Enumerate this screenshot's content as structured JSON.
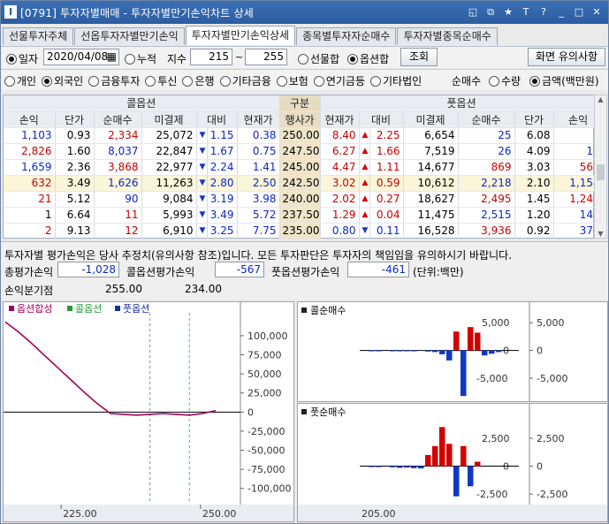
{
  "window": {
    "title": "[0791] 투자자별매매 - 투자자별만기손익차트 상세",
    "icon_letter": "I"
  },
  "titlebar_icons": [
    "restore-icon",
    "copy-icon",
    "star-icon",
    "font-icon",
    "help-icon",
    "minimize-icon",
    "maximize-icon",
    "close-icon"
  ],
  "titlebar_glyphs": [
    "◱",
    "⧉",
    "★",
    "T",
    "?",
    "_",
    "□",
    "✕"
  ],
  "tabs": [
    {
      "label": "선물투자주체",
      "active": false
    },
    {
      "label": "선옵투자자별만기손익",
      "active": false
    },
    {
      "label": "투자자별만기손익상세",
      "active": true
    },
    {
      "label": "종목별투자자순매수",
      "active": false
    },
    {
      "label": "투자자별종목순매수",
      "active": false
    }
  ],
  "controls": {
    "date_radio": "일자",
    "date_value": "2020/04/08",
    "cumulative_radio": "누적",
    "index_label": "지수",
    "index_from": "215",
    "tilde": "~",
    "index_to": "255",
    "futures_sum": "선물합",
    "options_sum": "옵션합",
    "query_button": "조회",
    "notice_button": "화면 유의사항"
  },
  "investors": [
    "개인",
    "외국인",
    "금융투자",
    "투신",
    "은행",
    "기타금융",
    "보험",
    "연기금등",
    "기타법인"
  ],
  "investor_selected": "외국인",
  "net_label": "순매수",
  "qty_radio": "수량",
  "amount_radio": "금액(백만원)",
  "table": {
    "call_header": "콜옵션",
    "mid_header": "구분",
    "put_header": "풋옵션",
    "call_cols": [
      "손익",
      "단가",
      "순매수",
      "미결제",
      "대비",
      "현재가"
    ],
    "mid_col": "행사가",
    "put_cols": [
      "현재가",
      "대비",
      "미결제",
      "순매수",
      "단가",
      "손익"
    ],
    "rows": [
      {
        "c": [
          "1,103",
          "0.93",
          "2,334",
          "25,072",
          "▼",
          "1.15",
          "0.38"
        ],
        "s": "250.00",
        "p": [
          "8.40",
          "▲",
          "2.25",
          "6,654",
          "25",
          "6.08",
          "9"
        ],
        "cc": [
          "b",
          "k",
          "r",
          "k",
          "dn",
          "b",
          "b"
        ],
        "pc": [
          "r",
          "up",
          "r",
          "k",
          "b",
          "k",
          "b"
        ],
        "hl": false
      },
      {
        "c": [
          "2,826",
          "1.60",
          "8,037",
          "22,847",
          "▼",
          "1.67",
          "0.75"
        ],
        "s": "247.50",
        "p": [
          "6.27",
          "▲",
          "1.66",
          "7,519",
          "26",
          "4.09",
          "11"
        ],
        "cc": [
          "r",
          "k",
          "b",
          "k",
          "dn",
          "b",
          "b"
        ],
        "pc": [
          "r",
          "up",
          "r",
          "k",
          "b",
          "k",
          "b"
        ],
        "hl": false
      },
      {
        "c": [
          "1,659",
          "2.36",
          "3,868",
          "22,977",
          "▼",
          "2.24",
          "1.41"
        ],
        "s": "245.00",
        "p": [
          "4.47",
          "▲",
          "1.11",
          "14,677",
          "869",
          "3.03",
          "562"
        ],
        "cc": [
          "b",
          "k",
          "r",
          "k",
          "dn",
          "b",
          "b"
        ],
        "pc": [
          "r",
          "up",
          "r",
          "k",
          "r",
          "k",
          "r"
        ],
        "hl": false
      },
      {
        "c": [
          "632",
          "3.49",
          "1,626",
          "11,263",
          "▼",
          "2.80",
          "2.50"
        ],
        "s": "242.50",
        "p": [
          "3.02",
          "▲",
          "0.59",
          "10,612",
          "2,218",
          "2.10",
          "1,154"
        ],
        "cc": [
          "r",
          "k",
          "b",
          "k",
          "dn",
          "b",
          "b"
        ],
        "pc": [
          "r",
          "up",
          "r",
          "k",
          "b",
          "k",
          "b"
        ],
        "hl": true
      },
      {
        "c": [
          "21",
          "5.12",
          "90",
          "9,084",
          "▼",
          "3.19",
          "3.98"
        ],
        "s": "240.00",
        "p": [
          "2.02",
          "▲",
          "0.27",
          "18,627",
          "2,495",
          "1.45",
          "1,242"
        ],
        "cc": [
          "r",
          "k",
          "b",
          "k",
          "dn",
          "b",
          "b"
        ],
        "pc": [
          "r",
          "up",
          "r",
          "k",
          "r",
          "k",
          "r"
        ],
        "hl": false
      },
      {
        "c": [
          "1",
          "6.64",
          "11",
          "5,993",
          "▼",
          "3.49",
          "5.72"
        ],
        "s": "237.50",
        "p": [
          "1.29",
          "▲",
          "0.04",
          "11,475",
          "2,515",
          "1.20",
          "143"
        ],
        "cc": [
          "k",
          "k",
          "r",
          "k",
          "dn",
          "b",
          "b"
        ],
        "pc": [
          "r",
          "up",
          "r",
          "k",
          "b",
          "k",
          "b"
        ],
        "hl": false
      },
      {
        "c": [
          "2",
          "9.13",
          "12",
          "6,910",
          "▼",
          "3.25",
          "7.75"
        ],
        "s": "235.00",
        "p": [
          "0.80",
          "▼",
          "0.11",
          "16,528",
          "3,936",
          "0.92",
          "370"
        ],
        "cc": [
          "r",
          "k",
          "r",
          "k",
          "dn",
          "b",
          "b"
        ],
        "pc": [
          "b",
          "dn",
          "b",
          "k",
          "r",
          "k",
          "b"
        ],
        "hl": false
      }
    ]
  },
  "info": {
    "notice": "투자자별 평가손익은 당사 추정치(유의사항 참조)입니다. 모든 투자판단은 투자자의 책임임을 유의하시기 바랍니다.",
    "total_label": "총평가손익",
    "total_value": "-1,028",
    "call_label": "콜옵션평가손익",
    "call_value": "-567",
    "put_label": "풋옵션평가손익",
    "put_value": "-461",
    "unit": "(단위:백만)",
    "bep_label": "손익분기점",
    "bep1": "255.00",
    "bep2": "234.00"
  },
  "colors": {
    "accent": "#2c5da0",
    "up": "#d40000",
    "down": "#1038c8",
    "sum_line": "#a0005a",
    "call_line": "#2a9a3a",
    "put_line": "#1a2aa8"
  },
  "chart_data": [
    {
      "type": "line",
      "legend": [
        "옵션합성",
        "콜옵션",
        "풋옵션"
      ],
      "y_ticks": [
        "100,000",
        "75,000",
        "50,000",
        "25,000",
        "0",
        "-25,000",
        "-50,000",
        "-75,000",
        "-100,000"
      ],
      "x_ticks": [
        "225.00",
        "250.00"
      ],
      "x": [
        215,
        217.5,
        220,
        222.5,
        225,
        227.5,
        230,
        232.5,
        235,
        237.5,
        240,
        242.5,
        245,
        247.5,
        250,
        252.5,
        255
      ],
      "series": [
        {
          "name": "옵션합성",
          "values": [
            118000,
            105000,
            90000,
            74000,
            58000,
            42000,
            26000,
            11000,
            -2000,
            -3000,
            -4000,
            -3000,
            -2000,
            -3000,
            -4000,
            -2000,
            2000
          ]
        }
      ],
      "ylim": [
        -120000,
        130000
      ]
    },
    {
      "type": "bar",
      "title": "콜순매수",
      "y_ticks": [
        "5,000",
        "0",
        "-5,000"
      ],
      "values": [
        0,
        -50,
        -100,
        0,
        -80,
        -120,
        -60,
        -150,
        0,
        -200,
        -300,
        -700,
        -1800,
        3400,
        -8200,
        4200,
        3200,
        -900,
        -600,
        -300,
        0
      ],
      "ylim": [
        -8500,
        5500
      ]
    },
    {
      "type": "bar",
      "title": "풋순매수",
      "y_ticks": [
        "2,500",
        "0",
        "-2,500"
      ],
      "x_ticks": [
        "205.00"
      ],
      "values": [
        0,
        -50,
        -60,
        0,
        -100,
        -150,
        -120,
        -180,
        -200,
        1000,
        1800,
        3500,
        2000,
        -2700,
        1800,
        -1800,
        400,
        0,
        0,
        0,
        0
      ],
      "ylim": [
        -3200,
        4000
      ]
    }
  ]
}
